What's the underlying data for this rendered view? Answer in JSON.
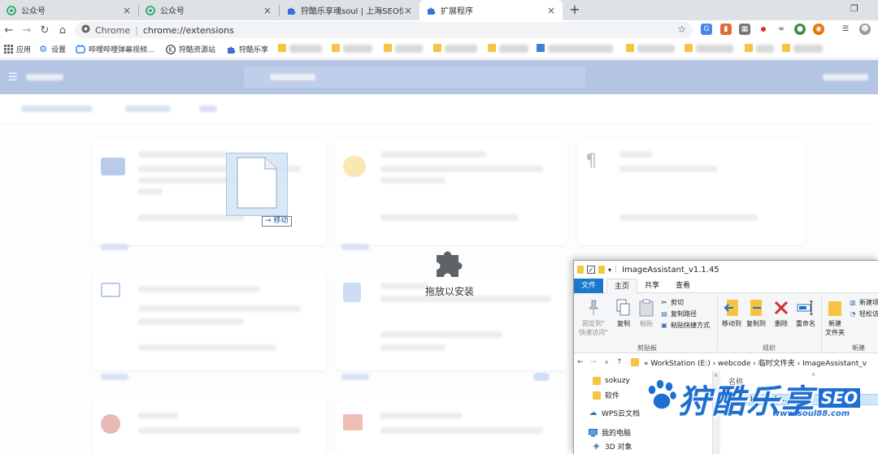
{
  "browser": {
    "tabs": [
      {
        "title": "公众号",
        "icon": "wechat-mp-icon"
      },
      {
        "title": "公众号",
        "icon": "wechat-mp-icon"
      },
      {
        "title": "狩酷乐享魂soul | 上海SEO优化",
        "icon": "puzzle-icon"
      },
      {
        "title": "扩展程序",
        "icon": "puzzle-icon"
      }
    ],
    "address": {
      "scheme_label": "Chrome",
      "url": "chrome://extensions"
    },
    "bookmarks": [
      {
        "label": "应用",
        "icon": "apps-icon"
      },
      {
        "label": "设置",
        "icon": "gear-icon"
      },
      {
        "label": "哔哩哔哩弹幕视频...",
        "icon": "bilibili-icon"
      },
      {
        "label": "狩酷资源站",
        "icon": "k-logo-icon"
      },
      {
        "label": "狩酷乐享",
        "icon": "puzzle-icon"
      }
    ]
  },
  "drop": {
    "text": "拖放以安装",
    "move_tag": "移动"
  },
  "explorer": {
    "title": "ImageAssistant_v1.1.45",
    "tabs": [
      "文件",
      "主页",
      "共享",
      "查看"
    ],
    "ribbon": {
      "pin": "固定到\"\n快速访问\"",
      "copy": "复制",
      "paste": "粘贴",
      "cut": "剪切",
      "copy_path": "复制路径",
      "paste_shortcut": "粘贴快捷方式",
      "group_clipboard": "剪贴板",
      "move_to": "移动到",
      "copy_to": "复制到",
      "delete": "删除",
      "rename": "重命名",
      "group_organize": "组织",
      "new_folder": "新建\n文件夹",
      "new_item": "新建项",
      "easy_access": "轻松访",
      "group_new": "新建"
    },
    "breadcrumb": "« WorkStation (E:) › webcode › 临时文件夹 › ImageAssistant_v",
    "nav_items": [
      {
        "label": "sokuzy",
        "icon": "folder-icon"
      },
      {
        "label": "软件",
        "icon": "folder-icon"
      },
      {
        "label": "WPS云文档",
        "icon": "cloud-icon"
      },
      {
        "label": "我的电脑",
        "icon": "computer-icon"
      },
      {
        "label": "3D 对象",
        "icon": "cube-3d-icon"
      }
    ],
    "column_name": "名称",
    "selected_file": "ImageAs..."
  },
  "watermark": {
    "logo": "狩酷乐享",
    "seo": "SEO",
    "url": "www.soul88.com"
  },
  "colors": {
    "accent": "#3b66b8",
    "explorer_file_tab": "#1979ca",
    "watermark": "#1f6fd1"
  }
}
